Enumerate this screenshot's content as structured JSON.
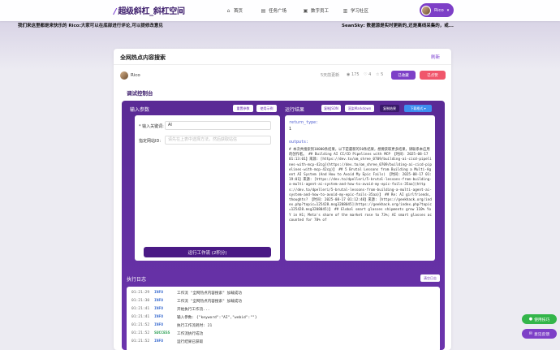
{
  "nav": {
    "logo": "超级斜杠_斜杠空间",
    "items": [
      {
        "icon": "home-icon",
        "glyph": "⌂",
        "label": "首页"
      },
      {
        "icon": "task-icon",
        "glyph": "▤",
        "label": "任务广场"
      },
      {
        "icon": "employee-icon",
        "glyph": "▣",
        "label": "数字员工"
      },
      {
        "icon": "book-icon",
        "glyph": "▥",
        "label": "学习社区"
      }
    ],
    "user": "Rico"
  },
  "marquee": {
    "left": "我们来这里都是来快乐的 Rico:大家可以在底部进行评论,可以提修改意见",
    "right": "SeanSky: 数据源是实时更新的,还是离线采集的，或..."
  },
  "panel": {
    "title": "全网热点内容搜索",
    "refresh": "刷新",
    "author": "Rico",
    "time_ago": "5天前更新",
    "views": "175",
    "likes": "4",
    "stars": "5",
    "subscribed": "已收藏",
    "purchased": "已点赞"
  },
  "console": {
    "section": "调试控制台",
    "input_title": "输入参数",
    "reset_btn": "重置参数",
    "example_btn": "使用示例",
    "keyword_label": "* 输入关键词:",
    "keyword_value": "AI",
    "site_label": "指定网站ID:",
    "site_placeholder": "请先在上表中选择方法，然后获取站信",
    "run_btn": "运行工作流 (2积分)",
    "result_title": "运行结果",
    "json_btn": "复制JSON",
    "markdown_btn": "渲染Markdown",
    "copy_btn": "复制结果",
    "download_btn": "下载格式 ▾",
    "return_key": "return_type:",
    "return_val": "1",
    "outputs_key": "outputs:",
    "outputs_text": "# 本次共搜索到10000条结果，以下是最新的50条结果，想要获取更多结果，请联系本应用的创作者。 ## Building AI CI/CD Pipelines with MCP 【时间: 2025-08-17 01:13:01】来源: [https://dev.to/om_shree_0709/building-ai-cicd-pipelines-with-mcp-42cg](https://dev.to/om_shree_0709/building-ai-cicd-pipelines-with-mcp-42cg)】 ## 5 Brutal Lessons from Building a Multi-Agent AI System (And How to Avoid My Epic Fails) 【时间: 2025-08-17 01:19:01】来源: [https://dev.to/dpelleri/5-brutal-lessons-from-building-a-multi-agent-ai-system-and-how-to-avoid-my-epic-fails-35aa](https://dev.to/dpelleri/5-brutal-lessons-from-building-a-multi-agent-ai-system-and-how-to-avoid-my-epic-fails-35aa)】 ## Re: AI girlfriends, thoughts? 【时间: 2025-08-17 01:12:48】来源: [https://geekhack.org/index.php?topic=125428.msg3208045](https://geekhack.org/index.php?topic=125428.msg3208045)】 ## Global smart glasses shipments grew 110% YoY in H1; Meta's share of the market rose to 73%; AI smart glasses accounted for 78% of"
  },
  "log": {
    "title": "执行日志",
    "clear_btn": "清空日志",
    "rows": [
      {
        "time": "01:21:29",
        "level": "INFO",
        "msg": "工作流 \"全网热点内容搜索\" 加载成功"
      },
      {
        "time": "01:21:30",
        "level": "INFO",
        "msg": "工作流 \"全网热点内容搜索\" 加载成功"
      },
      {
        "time": "01:21:41",
        "level": "INFO",
        "msg": "开始执行工作流..."
      },
      {
        "time": "01:21:41",
        "level": "INFO",
        "msg": "输入参数: {\"keyword\":\"AI\",\"webid\":\"\"}"
      },
      {
        "time": "01:21:52",
        "level": "INFO",
        "msg": "执行工作流耗时: 21"
      },
      {
        "time": "01:21:52",
        "level": "SUCCESS",
        "msg": "工作流执行成功"
      },
      {
        "time": "01:21:52",
        "level": "INFO",
        "msg": "运行结果已获取"
      }
    ]
  },
  "float": {
    "guide": "使用技巧",
    "feedback": "意见反馈"
  }
}
